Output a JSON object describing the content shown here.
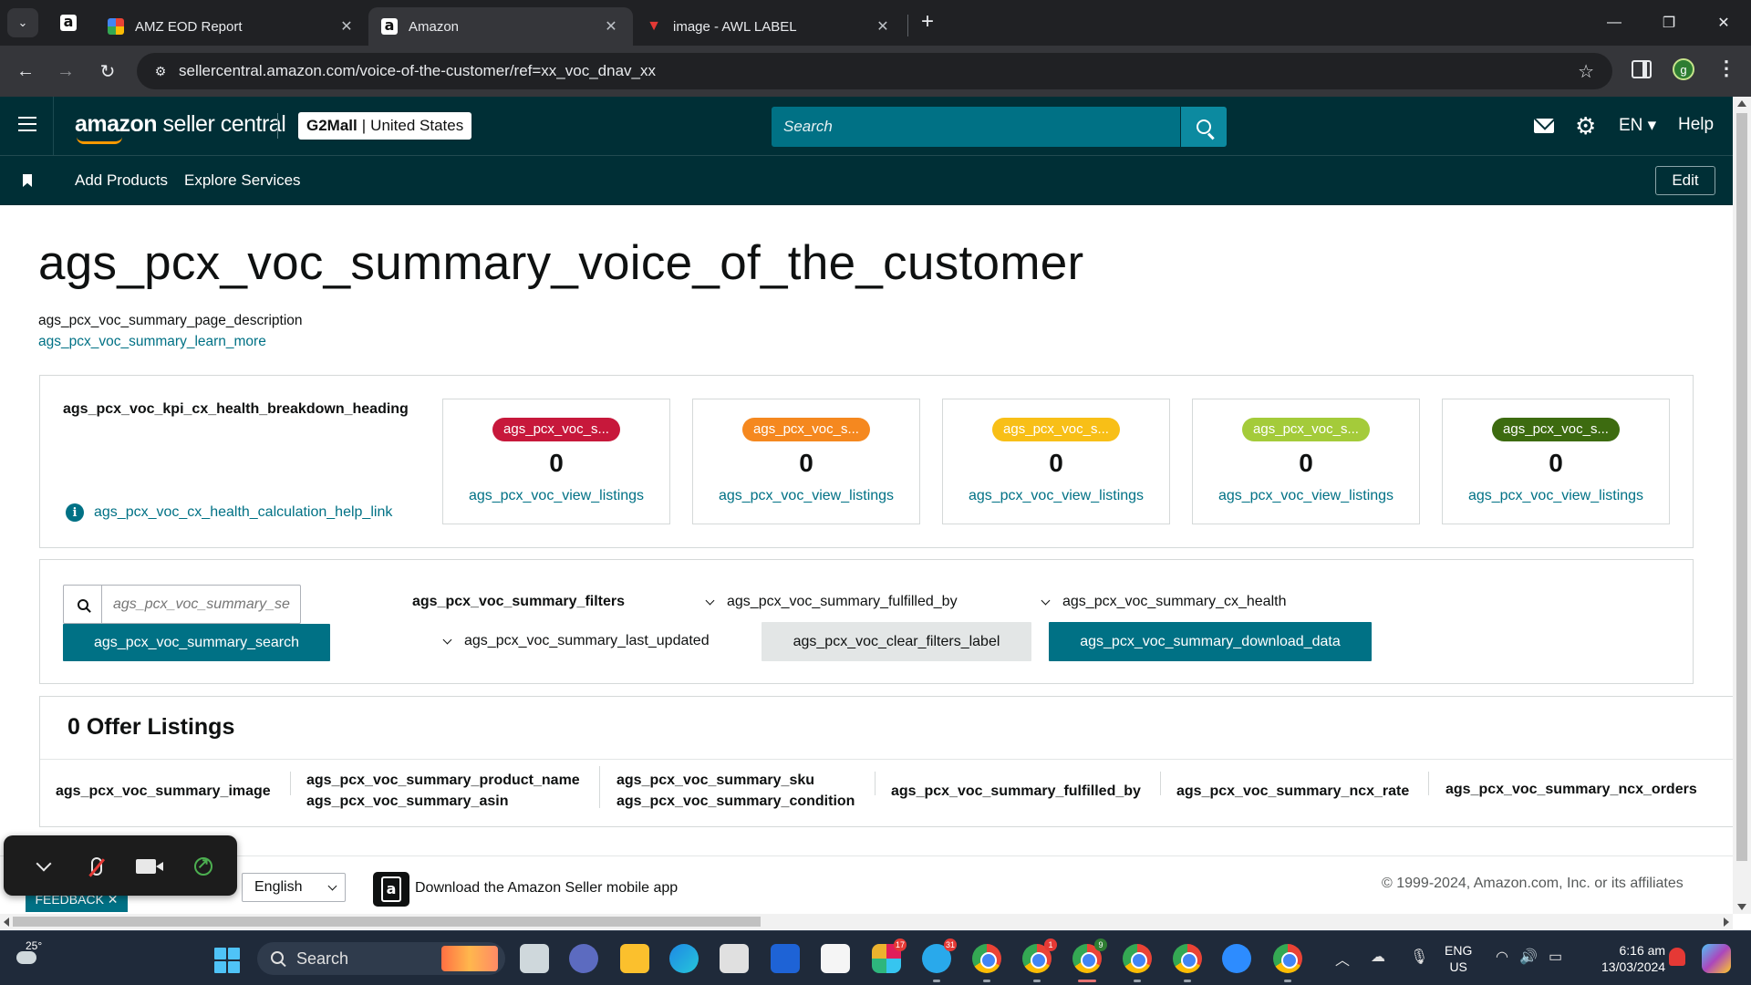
{
  "browser": {
    "tabs": [
      {
        "title": "AMZ EOD Report",
        "close": "✕"
      },
      {
        "title": "Amazon",
        "close": "✕"
      },
      {
        "title": "image - AWL LABEL",
        "close": "✕"
      }
    ],
    "new_tab": "+",
    "url_host": "sellercentral.amazon.com",
    "url_path": "/voice-of-the-customer/ref=xx_voc_dnav_xx",
    "profile_initial": "g"
  },
  "header": {
    "logo_amazon": "amazon",
    "logo_rest": " seller central",
    "store_name": "G2Mall",
    "store_sep": "|",
    "store_region": "United States",
    "search_placeholder": "Search",
    "language": "EN ▾",
    "help": "Help"
  },
  "subnav": {
    "items": [
      "Add Products",
      "Explore Services"
    ],
    "edit": "Edit"
  },
  "page": {
    "title": "ags_pcx_voc_summary_voice_of_the_customer",
    "description": "ags_pcx_voc_summary_page_description",
    "learn_more": "ags_pcx_voc_summary_learn_more"
  },
  "kpi": {
    "heading": "ags_pcx_voc_kpi_cx_health_breakdown_heading",
    "help_link": "ags_pcx_voc_cx_health_calculation_help_link",
    "cards": [
      {
        "badge": "ags_pcx_voc_s...",
        "value": "0",
        "link": "ags_pcx_voc_view_listings",
        "color": "#c7183b"
      },
      {
        "badge": "ags_pcx_voc_s...",
        "value": "0",
        "link": "ags_pcx_voc_view_listings",
        "color": "#f5881f"
      },
      {
        "badge": "ags_pcx_voc_s...",
        "value": "0",
        "link": "ags_pcx_voc_view_listings",
        "color": "#f8bf17"
      },
      {
        "badge": "ags_pcx_voc_s...",
        "value": "0",
        "link": "ags_pcx_voc_view_listings",
        "color": "#a4cb3a"
      },
      {
        "badge": "ags_pcx_voc_s...",
        "value": "0",
        "link": "ags_pcx_voc_view_listings",
        "color": "#3d6b10"
      }
    ]
  },
  "filters": {
    "search_placeholder": "ags_pcx_voc_summary_se",
    "search_button": "ags_pcx_voc_summary_search",
    "label": "ags_pcx_voc_summary_filters",
    "fulfilled_by": "ags_pcx_voc_summary_fulfilled_by",
    "cx_health": "ags_pcx_voc_summary_cx_health",
    "last_updated": "ags_pcx_voc_summary_last_updated",
    "clear": "ags_pcx_voc_clear_filters_label",
    "download": "ags_pcx_voc_summary_download_data"
  },
  "listings": {
    "title": "0 Offer Listings",
    "columns": {
      "image": "ags_pcx_voc_summary_image",
      "product_name": "ags_pcx_voc_summary_product_name",
      "asin": "ags_pcx_voc_summary_asin",
      "sku": "ags_pcx_voc_summary_sku",
      "condition": "ags_pcx_voc_summary_condition",
      "fulfilled_by": "ags_pcx_voc_summary_fulfilled_by",
      "ncx_rate": "ags_pcx_voc_summary_ncx_rate",
      "ncx_orders": "ags_pcx_voc_summary_ncx_orders"
    }
  },
  "footer": {
    "language": "English",
    "app_text": "Download the Amazon Seller mobile app",
    "copyright": "© 1999-2024, Amazon.com, Inc. or its affiliates",
    "feedback": "FEEDBACK ✕"
  },
  "taskbar": {
    "temperature": "25°",
    "search": "Search",
    "lang_line1": "ENG",
    "lang_line2": "US",
    "time": "6:16 am",
    "date": "13/03/2024",
    "badges": {
      "slack": "17",
      "telegram": "31",
      "chrome2": "1",
      "chrome3": "9"
    }
  },
  "colors": {
    "header_bg": "#002f36",
    "link": "#007185",
    "primary_button": "#007185"
  }
}
